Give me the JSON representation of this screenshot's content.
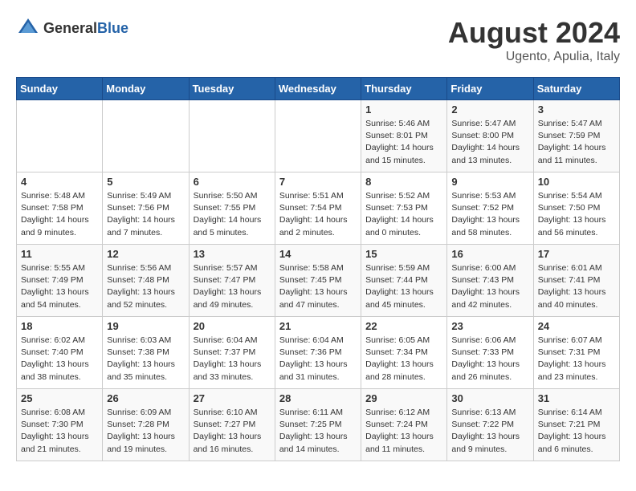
{
  "header": {
    "logo_general": "General",
    "logo_blue": "Blue",
    "month_year": "August 2024",
    "location": "Ugento, Apulia, Italy"
  },
  "days_of_week": [
    "Sunday",
    "Monday",
    "Tuesday",
    "Wednesday",
    "Thursday",
    "Friday",
    "Saturday"
  ],
  "weeks": [
    [
      {
        "day": "",
        "info": ""
      },
      {
        "day": "",
        "info": ""
      },
      {
        "day": "",
        "info": ""
      },
      {
        "day": "",
        "info": ""
      },
      {
        "day": "1",
        "info": "Sunrise: 5:46 AM\nSunset: 8:01 PM\nDaylight: 14 hours\nand 15 minutes."
      },
      {
        "day": "2",
        "info": "Sunrise: 5:47 AM\nSunset: 8:00 PM\nDaylight: 14 hours\nand 13 minutes."
      },
      {
        "day": "3",
        "info": "Sunrise: 5:47 AM\nSunset: 7:59 PM\nDaylight: 14 hours\nand 11 minutes."
      }
    ],
    [
      {
        "day": "4",
        "info": "Sunrise: 5:48 AM\nSunset: 7:58 PM\nDaylight: 14 hours\nand 9 minutes."
      },
      {
        "day": "5",
        "info": "Sunrise: 5:49 AM\nSunset: 7:56 PM\nDaylight: 14 hours\nand 7 minutes."
      },
      {
        "day": "6",
        "info": "Sunrise: 5:50 AM\nSunset: 7:55 PM\nDaylight: 14 hours\nand 5 minutes."
      },
      {
        "day": "7",
        "info": "Sunrise: 5:51 AM\nSunset: 7:54 PM\nDaylight: 14 hours\nand 2 minutes."
      },
      {
        "day": "8",
        "info": "Sunrise: 5:52 AM\nSunset: 7:53 PM\nDaylight: 14 hours\nand 0 minutes."
      },
      {
        "day": "9",
        "info": "Sunrise: 5:53 AM\nSunset: 7:52 PM\nDaylight: 13 hours\nand 58 minutes."
      },
      {
        "day": "10",
        "info": "Sunrise: 5:54 AM\nSunset: 7:50 PM\nDaylight: 13 hours\nand 56 minutes."
      }
    ],
    [
      {
        "day": "11",
        "info": "Sunrise: 5:55 AM\nSunset: 7:49 PM\nDaylight: 13 hours\nand 54 minutes."
      },
      {
        "day": "12",
        "info": "Sunrise: 5:56 AM\nSunset: 7:48 PM\nDaylight: 13 hours\nand 52 minutes."
      },
      {
        "day": "13",
        "info": "Sunrise: 5:57 AM\nSunset: 7:47 PM\nDaylight: 13 hours\nand 49 minutes."
      },
      {
        "day": "14",
        "info": "Sunrise: 5:58 AM\nSunset: 7:45 PM\nDaylight: 13 hours\nand 47 minutes."
      },
      {
        "day": "15",
        "info": "Sunrise: 5:59 AM\nSunset: 7:44 PM\nDaylight: 13 hours\nand 45 minutes."
      },
      {
        "day": "16",
        "info": "Sunrise: 6:00 AM\nSunset: 7:43 PM\nDaylight: 13 hours\nand 42 minutes."
      },
      {
        "day": "17",
        "info": "Sunrise: 6:01 AM\nSunset: 7:41 PM\nDaylight: 13 hours\nand 40 minutes."
      }
    ],
    [
      {
        "day": "18",
        "info": "Sunrise: 6:02 AM\nSunset: 7:40 PM\nDaylight: 13 hours\nand 38 minutes."
      },
      {
        "day": "19",
        "info": "Sunrise: 6:03 AM\nSunset: 7:38 PM\nDaylight: 13 hours\nand 35 minutes."
      },
      {
        "day": "20",
        "info": "Sunrise: 6:04 AM\nSunset: 7:37 PM\nDaylight: 13 hours\nand 33 minutes."
      },
      {
        "day": "21",
        "info": "Sunrise: 6:04 AM\nSunset: 7:36 PM\nDaylight: 13 hours\nand 31 minutes."
      },
      {
        "day": "22",
        "info": "Sunrise: 6:05 AM\nSunset: 7:34 PM\nDaylight: 13 hours\nand 28 minutes."
      },
      {
        "day": "23",
        "info": "Sunrise: 6:06 AM\nSunset: 7:33 PM\nDaylight: 13 hours\nand 26 minutes."
      },
      {
        "day": "24",
        "info": "Sunrise: 6:07 AM\nSunset: 7:31 PM\nDaylight: 13 hours\nand 23 minutes."
      }
    ],
    [
      {
        "day": "25",
        "info": "Sunrise: 6:08 AM\nSunset: 7:30 PM\nDaylight: 13 hours\nand 21 minutes."
      },
      {
        "day": "26",
        "info": "Sunrise: 6:09 AM\nSunset: 7:28 PM\nDaylight: 13 hours\nand 19 minutes."
      },
      {
        "day": "27",
        "info": "Sunrise: 6:10 AM\nSunset: 7:27 PM\nDaylight: 13 hours\nand 16 minutes."
      },
      {
        "day": "28",
        "info": "Sunrise: 6:11 AM\nSunset: 7:25 PM\nDaylight: 13 hours\nand 14 minutes."
      },
      {
        "day": "29",
        "info": "Sunrise: 6:12 AM\nSunset: 7:24 PM\nDaylight: 13 hours\nand 11 minutes."
      },
      {
        "day": "30",
        "info": "Sunrise: 6:13 AM\nSunset: 7:22 PM\nDaylight: 13 hours\nand 9 minutes."
      },
      {
        "day": "31",
        "info": "Sunrise: 6:14 AM\nSunset: 7:21 PM\nDaylight: 13 hours\nand 6 minutes."
      }
    ]
  ]
}
